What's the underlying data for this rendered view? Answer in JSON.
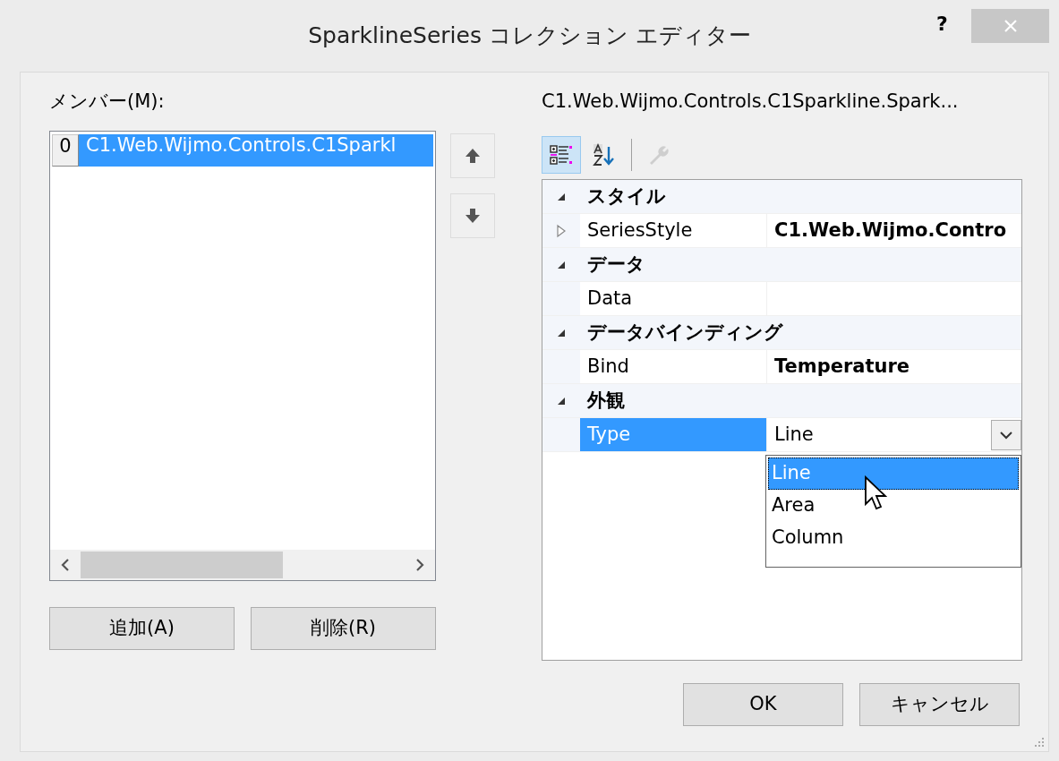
{
  "window": {
    "title": "SparklineSeries コレクション エディター",
    "help": "?"
  },
  "members": {
    "label": "メンバー(M):",
    "items": [
      {
        "index": "0",
        "text": "C1.Web.Wijmo.Controls.C1Sparkl",
        "selected": true
      }
    ],
    "buttons": [
      "追加(A)",
      "削除(R)"
    ]
  },
  "properties": {
    "title": "C1.Web.Wijmo.Controls.C1Sparkline.Spark...",
    "toolbar": [
      {
        "kind": "categorized",
        "selected": true,
        "disabled": false
      },
      {
        "kind": "alphabetical",
        "selected": false,
        "disabled": false
      },
      {
        "kind": "pages",
        "selected": false,
        "disabled": true
      }
    ],
    "categories": [
      {
        "name": "スタイル",
        "expanded": true,
        "properties": [
          {
            "name": "SeriesStyle",
            "value": "C1.Web.Wijmo.Contro",
            "expandable": true,
            "modified": true,
            "selected": false,
            "dropdown": false
          }
        ]
      },
      {
        "name": "データ",
        "expanded": true,
        "properties": [
          {
            "name": "Data",
            "expandable": false,
            "selected": false,
            "dropdown": false
          }
        ]
      },
      {
        "name": "データバインディング",
        "expanded": true,
        "properties": [
          {
            "name": "Bind",
            "value": "Temperature",
            "expandable": false,
            "modified": true,
            "selected": false,
            "dropdown": false
          }
        ]
      },
      {
        "name": "外観",
        "expanded": true,
        "properties": [
          {
            "name": "Type",
            "value": "Line",
            "expandable": false,
            "modified": false,
            "selected": true,
            "dropdown": true
          }
        ]
      }
    ],
    "dropdown": {
      "options": [
        {
          "label": "Line",
          "selected": true
        },
        {
          "label": "Area",
          "selected": false
        },
        {
          "label": "Column",
          "selected": false
        }
      ]
    }
  },
  "footer_buttons": [
    "OK",
    "キャンセル"
  ]
}
